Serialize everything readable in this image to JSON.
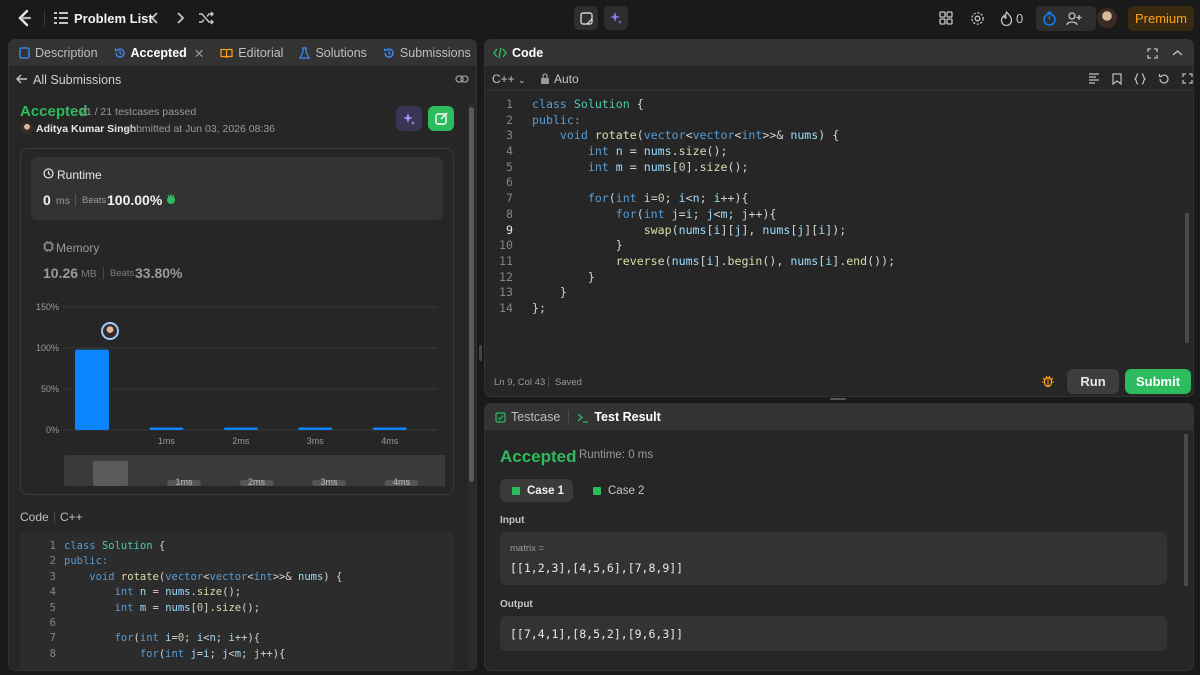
{
  "topbar": {
    "problem_list": "Problem List",
    "fire_count": "0",
    "premium": "Premium"
  },
  "left_panel": {
    "tabs": [
      "Description",
      "Accepted",
      "Editorial",
      "Solutions",
      "Submissions"
    ],
    "all_submissions": "All Submissions",
    "status": "Accepted",
    "testcases": "21 / 21 testcases passed",
    "user": "Aditya Kumar Singh",
    "submitted_at": "submitted at Jun 03, 2026 08:36",
    "runtime": {
      "label": "Runtime",
      "value": "0",
      "unit": "ms",
      "beats_label": "Beats",
      "beats": "100.00%"
    },
    "memory": {
      "label": "Memory",
      "value": "10.26",
      "unit": "MB",
      "beats_label": "Beats",
      "beats": "33.80%"
    },
    "code_label": "Code",
    "code_lang": "C++"
  },
  "chart_data": {
    "type": "bar",
    "categories": [
      "",
      "1ms",
      "2ms",
      "3ms",
      "4ms"
    ],
    "values": [
      98,
      3,
      3,
      3,
      3
    ],
    "y_ticks": [
      "150%",
      "100%",
      "50%",
      "0%"
    ],
    "ylim": [
      0,
      150
    ],
    "brush_labels": [
      "1ms",
      "2ms",
      "3ms",
      "4ms"
    ],
    "bar_color": "#0a84ff"
  },
  "left_code": [
    "class Solution {",
    "public:",
    "    void rotate(vector<vector<int>>& nums) {",
    "        int n = nums.size();",
    "        int m = nums[0].size();",
    "",
    "        for(int i=0; i<n; i++){",
    "            for(int j=i; j<m; j++){"
  ],
  "code_panel": {
    "title": "Code",
    "lang": "C++",
    "auto": "Auto",
    "status_pos": "Ln 9, Col 43",
    "status_saved": "Saved",
    "run": "Run",
    "submit": "Submit"
  },
  "editor_lines": [
    "class Solution {",
    "public:",
    "    void rotate(vector<vector<int>>& nums) {",
    "        int n = nums.size();",
    "        int m = nums[0].size();",
    "",
    "        for(int i=0; i<n; i++){",
    "            for(int j=i; j<m; j++){",
    "                swap(nums[i][j], nums[j][i]);",
    "            }",
    "            reverse(nums[i].begin(), nums[i].end());",
    "        }",
    "    }",
    "};"
  ],
  "result_panel": {
    "tab_testcase": "Testcase",
    "tab_result": "Test Result",
    "status": "Accepted",
    "runtime": "Runtime: 0 ms",
    "case1": "Case 1",
    "case2": "Case 2",
    "input_label": "Input",
    "input_var": "matrix =",
    "input_value": "[[1,2,3],[4,5,6],[7,8,9]]",
    "output_label": "Output",
    "output_value": "[[7,4,1],[8,5,2],[9,6,3]]"
  },
  "colors": {
    "accent_green": "#2cbb5d",
    "premium": "#ffa116",
    "blue": "#0a84ff"
  }
}
